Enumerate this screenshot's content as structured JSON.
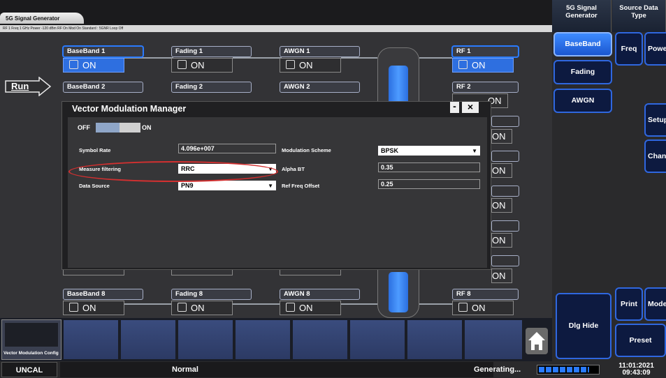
{
  "header": {
    "tab_title": "5G Signal Generator",
    "status_line": "RF 1 Freq 1 GHz Power -120 dBm  RF On  Mod On  Standard : 5GNR  Loop Off"
  },
  "run_label": "Run",
  "rows": [
    {
      "baseband": "BaseBand 1",
      "fading": "Fading 1",
      "awgn": "AWGN 1",
      "rf": "RF 1",
      "bb_state": "ON",
      "fd_state": "ON",
      "aw_state": "ON",
      "rf_state": "ON"
    },
    {
      "baseband": "BaseBand 2",
      "fading": "Fading 2",
      "awgn": "AWGN 2",
      "rf": "RF 2",
      "rf_state": "ON"
    },
    {
      "baseband": "BaseBand 8",
      "fading": "Fading 8",
      "awgn": "AWGN 8",
      "rf": "RF 8",
      "bb_state": "ON",
      "fd_state": "ON",
      "aw_state": "ON",
      "rf_state": "ON"
    }
  ],
  "partial_on": "ON",
  "dialog": {
    "title": "Vector Modulation Manager",
    "min": "-",
    "close": "×",
    "off_label": "OFF",
    "on_label": "ON",
    "symbol_rate_label": "Symbol Rate",
    "symbol_rate_value": "4.096e+007",
    "mod_scheme_label": "Modulation Scheme",
    "mod_scheme_value": "BPSK",
    "measure_filtering_label": "Measure filtering",
    "measure_filtering_value": "RRC",
    "alpha_label": "Alpha BT",
    "alpha_value": "0.35",
    "data_source_label": "Data Source",
    "data_source_value": "PN9",
    "ref_freq_label": "Ref Freq Offset",
    "ref_freq_value": "0.25"
  },
  "right_panel": {
    "head1": "5G Signal Generator",
    "head2": "Source Data Type",
    "baseband": "BaseBand",
    "fading": "Fading",
    "awgn": "AWGN",
    "freq": "Freq",
    "power": "Powe",
    "setup": "Setup",
    "chan": "Chan",
    "print": "Print",
    "mode": "Mode",
    "dlg_hide": "Dlg Hide",
    "preset": "Preset"
  },
  "thumb_label": "Vector Modulation Config",
  "footer": {
    "uncal": "UNCAL",
    "normal": "Normal",
    "generating": "Generating...",
    "date": "11:01:2021",
    "time": "09:43:09"
  },
  "colors": {
    "accent": "#2a7bff",
    "highlight": "#d23030"
  }
}
